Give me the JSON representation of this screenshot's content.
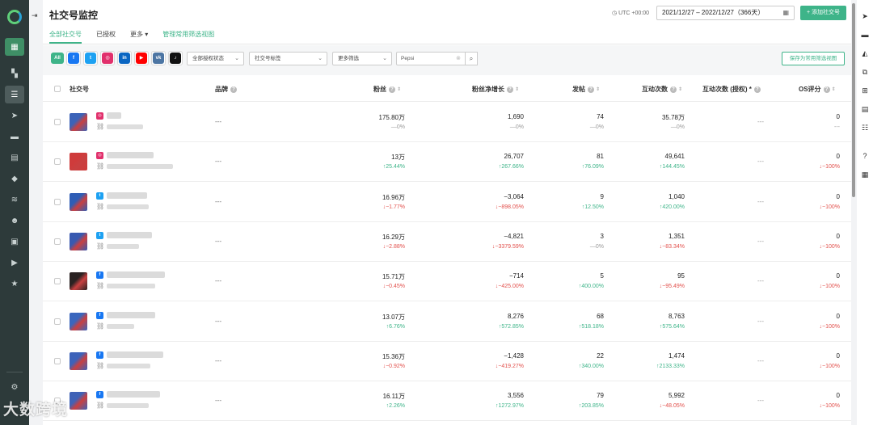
{
  "page": {
    "title": "社交号监控",
    "timezone": "UTC +00:00",
    "date_range": "2021/12/27 – 2022/12/27（366天）",
    "add_button": "+ 添加社交号"
  },
  "tabs": [
    {
      "label": "全部社交号",
      "active": true
    },
    {
      "label": "已授权"
    },
    {
      "label": "更多 ▾"
    },
    {
      "label": "管理常用筛选视图",
      "link": true
    }
  ],
  "filters": {
    "networks": [
      {
        "name": "all",
        "label": "All",
        "color": "#3eb489"
      },
      {
        "name": "facebook",
        "label": "f",
        "color": "#1877f2"
      },
      {
        "name": "twitter",
        "label": "t",
        "color": "#1da1f2"
      },
      {
        "name": "instagram",
        "label": "◎",
        "color": "#e1306c"
      },
      {
        "name": "linkedin",
        "label": "in",
        "color": "#0a66c2"
      },
      {
        "name": "youtube",
        "label": "▶",
        "color": "#ff0000"
      },
      {
        "name": "vk",
        "label": "vk",
        "color": "#4c75a3"
      },
      {
        "name": "tiktok",
        "label": "♪",
        "color": "#111111"
      }
    ],
    "auth_status": "全部授权状态",
    "account_tags": "社交号标签",
    "more_filters": "更多筛选",
    "search_value": "Pepsi",
    "save_view": "保存为常用筛选视图"
  },
  "columns": {
    "account": "社交号",
    "brand": "品牌",
    "fans": "粉丝",
    "fans_net": "粉丝净增长",
    "posts": "发帖",
    "interactions": "互动次数",
    "interactions_auth": "互动次数 (授权) *",
    "os_score": "OS评分"
  },
  "rows": [
    {
      "network": "instagram",
      "avatar_color": "#3c63b8",
      "brand": "---",
      "fans": "175.80万",
      "fans_chg": "—0%",
      "fans_dir": "flat",
      "net": "1,690",
      "net_chg": "—0%",
      "net_dir": "flat",
      "posts": "74",
      "posts_chg": "—0%",
      "posts_dir": "flat",
      "inter": "35.78万",
      "inter_chg": "—0%",
      "inter_dir": "flat",
      "inter_auth": "---",
      "os": "0",
      "os_chg": "---",
      "os_dir": "flat"
    },
    {
      "network": "instagram",
      "avatar_color": "#cf3b3b",
      "brand": "---",
      "fans": "13万",
      "fans_chg": "↑25.44%",
      "fans_dir": "up",
      "net": "26,707",
      "net_chg": "↑267.66%",
      "net_dir": "up",
      "posts": "81",
      "posts_chg": "↑76.09%",
      "posts_dir": "up",
      "inter": "49,641",
      "inter_chg": "↑144.45%",
      "inter_dir": "up",
      "inter_auth": "---",
      "os": "0",
      "os_chg": "↓−100%",
      "os_dir": "down"
    },
    {
      "network": "twitter",
      "avatar_color": "#2f5db5",
      "brand": "---",
      "fans": "16.96万",
      "fans_chg": "↓−1.77%",
      "fans_dir": "down",
      "net": "−3,064",
      "net_chg": "↓−898.05%",
      "net_dir": "down",
      "posts": "9",
      "posts_chg": "↑12.50%",
      "posts_dir": "up",
      "inter": "1,040",
      "inter_chg": "↑420.00%",
      "inter_dir": "up",
      "inter_auth": "---",
      "os": "0",
      "os_chg": "↓−100%",
      "os_dir": "down"
    },
    {
      "network": "twitter",
      "avatar_color": "#3859b0",
      "brand": "---",
      "fans": "16.29万",
      "fans_chg": "↓−2.88%",
      "fans_dir": "down",
      "net": "−4,821",
      "net_chg": "↓−3379.59%",
      "net_dir": "down",
      "posts": "3",
      "posts_chg": "—0%",
      "posts_dir": "flat",
      "inter": "1,351",
      "inter_chg": "↓−83.34%",
      "inter_dir": "down",
      "inter_auth": "---",
      "os": "0",
      "os_chg": "↓−100%",
      "os_dir": "down"
    },
    {
      "network": "facebook",
      "avatar_color": "#2a2222",
      "brand": "---",
      "fans": "15.71万",
      "fans_chg": "↓−0.45%",
      "fans_dir": "down",
      "net": "−714",
      "net_chg": "↓−425.00%",
      "net_dir": "down",
      "posts": "5",
      "posts_chg": "↑400.00%",
      "posts_dir": "up",
      "inter": "95",
      "inter_chg": "↓−95.49%",
      "inter_dir": "down",
      "inter_auth": "---",
      "os": "0",
      "os_chg": "↓−100%",
      "os_dir": "down"
    },
    {
      "network": "facebook",
      "avatar_color": "#3a66bd",
      "brand": "---",
      "fans": "13.07万",
      "fans_chg": "↑6.76%",
      "fans_dir": "up",
      "net": "8,276",
      "net_chg": "↑572.85%",
      "net_dir": "up",
      "posts": "68",
      "posts_chg": "↑518.18%",
      "posts_dir": "up",
      "inter": "8,763",
      "inter_chg": "↑575.64%",
      "inter_dir": "up",
      "inter_auth": "---",
      "os": "0",
      "os_chg": "↓−100%",
      "os_dir": "down"
    },
    {
      "network": "facebook",
      "avatar_color": "#3d62b9",
      "brand": "---",
      "fans": "15.36万",
      "fans_chg": "↓−0.92%",
      "fans_dir": "down",
      "net": "−1,428",
      "net_chg": "↓−419.27%",
      "net_dir": "down",
      "posts": "22",
      "posts_chg": "↑340.00%",
      "posts_dir": "up",
      "inter": "1,474",
      "inter_chg": "↑2133.33%",
      "inter_dir": "up",
      "inter_auth": "---",
      "os": "0",
      "os_chg": "↓−100%",
      "os_dir": "down"
    },
    {
      "network": "facebook",
      "avatar_color": "#4062b6",
      "brand": "---",
      "fans": "16.11万",
      "fans_chg": "↑2.26%",
      "fans_dir": "up",
      "net": "3,556",
      "net_chg": "↑1272.97%",
      "net_dir": "up",
      "posts": "79",
      "posts_chg": "↑203.85%",
      "posts_dir": "up",
      "inter": "5,992",
      "inter_chg": "↓−48.05%",
      "inter_dir": "down",
      "inter_auth": "---",
      "os": "0",
      "os_chg": "↓−100%",
      "os_dir": "down"
    }
  ],
  "sidebar_icons": [
    "apps-icon",
    "dashboard-icon",
    "list-icon",
    "send-icon",
    "chat-icon",
    "document-icon",
    "tag-icon",
    "audio-icon",
    "users-icon",
    "image-icon",
    "video-icon",
    "star-icon",
    "settings-icon",
    "support-icon"
  ],
  "rail_icons": [
    "navigate-icon",
    "message-icon",
    "bell-icon",
    "translate-icon",
    "add-icon",
    "folder-add-icon",
    "filter-list-icon",
    "help-icon",
    "qrcode-icon"
  ],
  "watermark": "大数跨境",
  "colors": {
    "accent": "#3eb489",
    "down": "#e2504c",
    "sidebar": "#2d3a3a"
  }
}
